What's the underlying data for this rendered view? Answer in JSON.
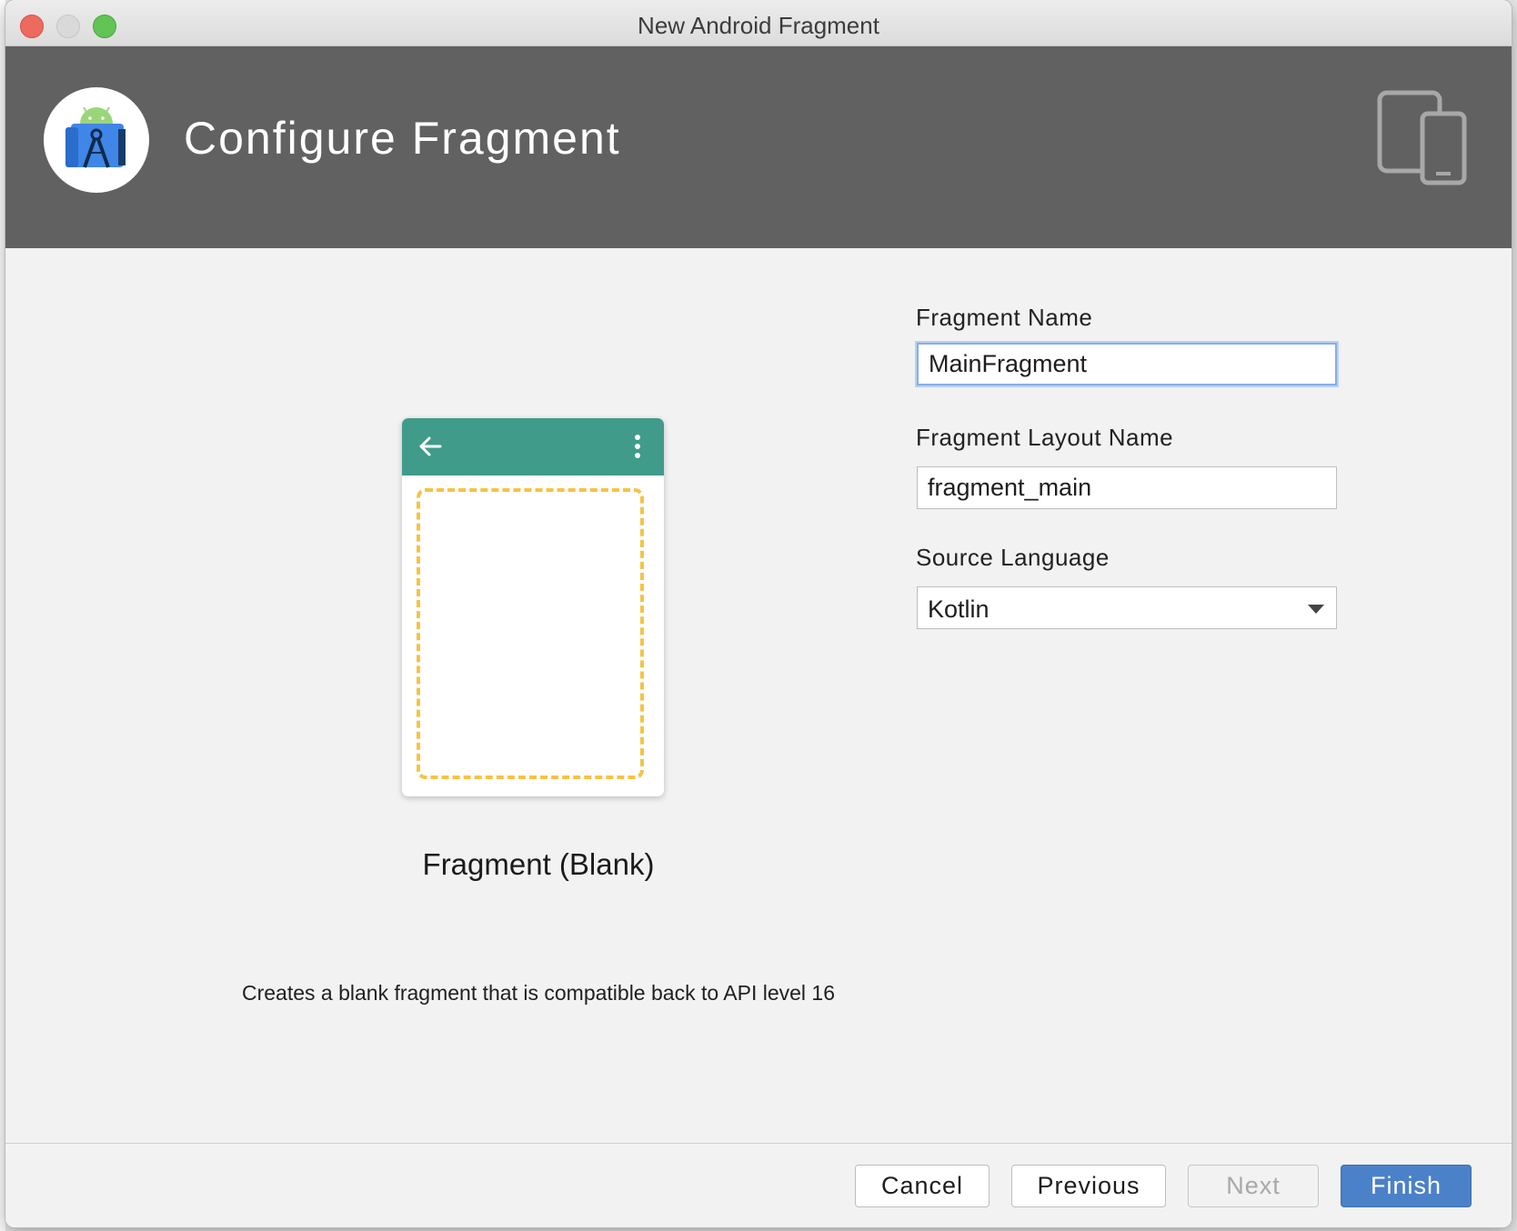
{
  "window": {
    "title": "New Android Fragment"
  },
  "header": {
    "title": "Configure Fragment",
    "logo_icon": "android-studio-logo-icon",
    "devices_icon": "tablet-phone-icon"
  },
  "preview": {
    "template_name": "Fragment (Blank)",
    "description": "Creates a blank fragment that is compatible back to API level 16",
    "toolbar_color": "#409b8a",
    "placeholder_color": "#f6c343"
  },
  "form": {
    "fragment_name": {
      "label": "Fragment Name",
      "value": "MainFragment"
    },
    "layout_name": {
      "label": "Fragment Layout Name",
      "value": "fragment_main"
    },
    "source_language": {
      "label": "Source Language",
      "value": "Kotlin"
    }
  },
  "footer": {
    "cancel": "Cancel",
    "previous": "Previous",
    "next": "Next",
    "finish": "Finish"
  },
  "colors": {
    "header_bg": "#616161",
    "primary_button": "#4b81c8",
    "focus_ring": "#88aee6"
  }
}
